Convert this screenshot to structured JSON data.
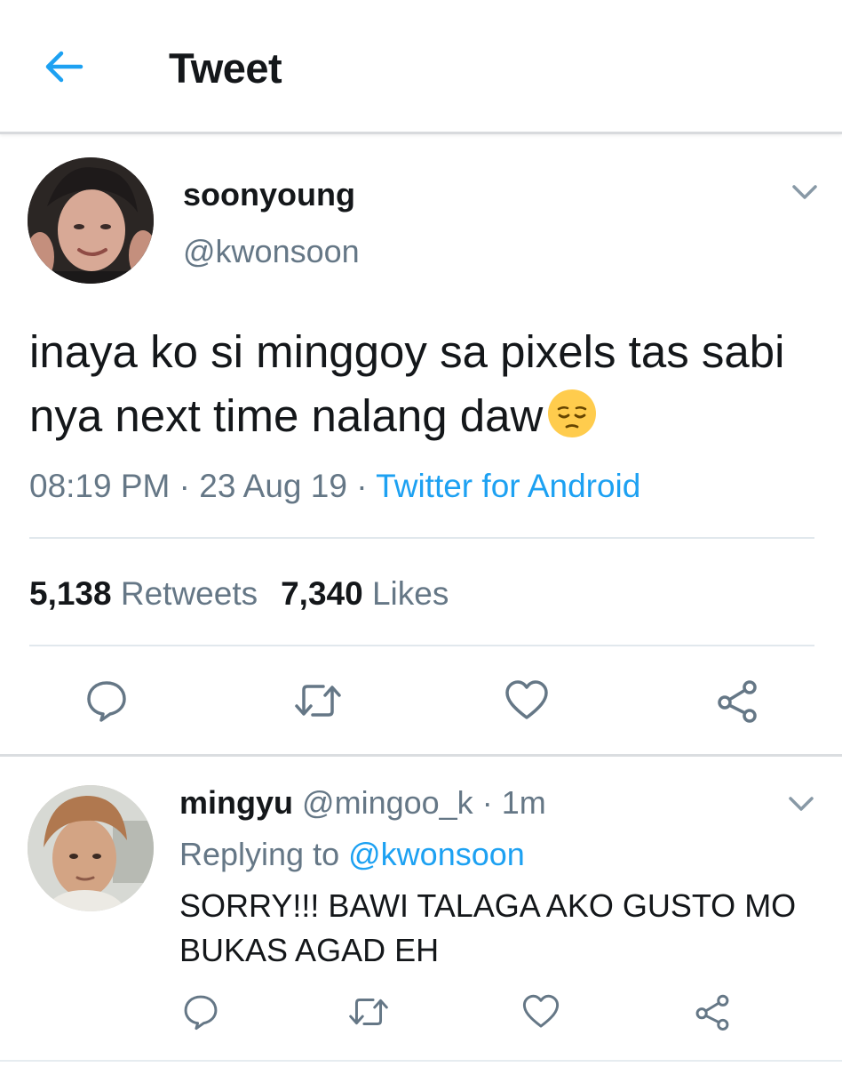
{
  "header": {
    "title": "Tweet",
    "back_icon": "back-arrow-icon"
  },
  "colors": {
    "accent": "#1da1f2",
    "secondary_text": "#657786",
    "primary_text": "#14171a",
    "divider": "#e1e8ed"
  },
  "tweet": {
    "display_name": "soonyoung",
    "handle": "@kwonsoon",
    "text": "inaya ko si minggoy sa pixels tas sabi nya next time nalang daw",
    "emoji": "pensive-face-emoji",
    "time": "08:19 PM",
    "date": "23 Aug 19",
    "separator": "·",
    "source": "Twitter for Android",
    "retweets_count": "5,138",
    "retweets_label": "Retweets",
    "likes_count": "7,340",
    "likes_label": "Likes"
  },
  "reply": {
    "display_name": "mingyu",
    "handle": "@mingoo_k",
    "separator": "·",
    "time": "1m",
    "replying_label": "Replying to",
    "replying_to": "@kwonsoon",
    "text": "SORRY!!! BAWI TALAGA AKO GUSTO MO BUKAS AGAD EH"
  },
  "actions": [
    "reply-icon",
    "retweet-icon",
    "like-heart-icon",
    "share-icon"
  ]
}
